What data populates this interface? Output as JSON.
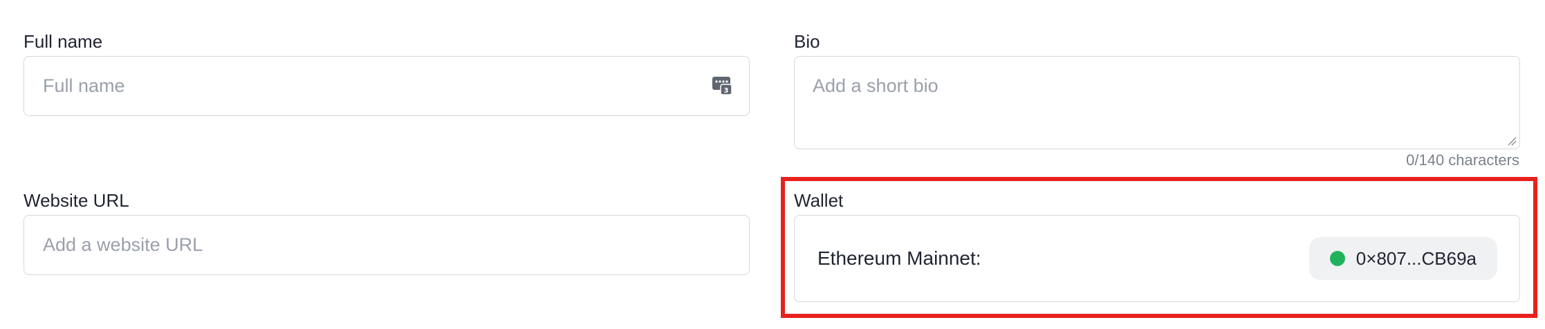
{
  "full_name": {
    "label": "Full name",
    "value": "",
    "placeholder": "Full name",
    "autofill_icon": "password-manager-icon"
  },
  "bio": {
    "label": "Bio",
    "value": "",
    "placeholder": "Add a short bio",
    "char_count": "0/140 characters"
  },
  "website": {
    "label": "Website URL",
    "value": "",
    "placeholder": "Add a website URL"
  },
  "wallet": {
    "label": "Wallet",
    "network": "Ethereum Mainnet:",
    "address": "0×807...CB69a",
    "status_color": "#1fb25a"
  },
  "colors": {
    "highlight": "#e8211c",
    "border": "#d4d7dd",
    "placeholder": "#9aa0aa"
  }
}
